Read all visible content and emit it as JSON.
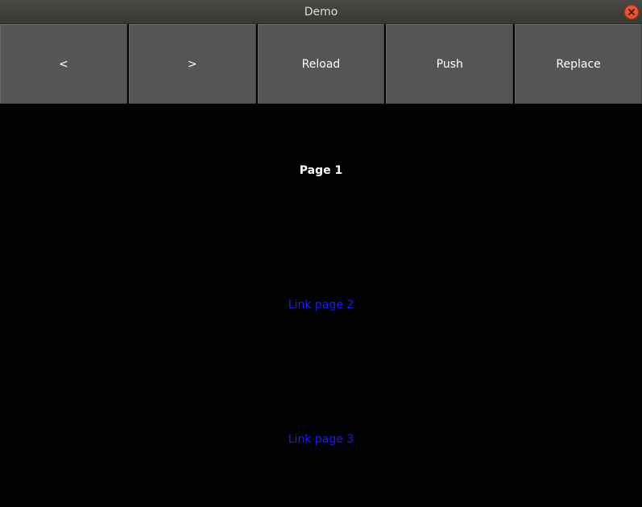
{
  "window": {
    "title": "Demo",
    "close_icon": "close-icon"
  },
  "toolbar": {
    "back_label": "<",
    "forward_label": ">",
    "reload_label": "Reload",
    "push_label": "Push",
    "replace_label": "Replace"
  },
  "page": {
    "title": "Page 1",
    "links": [
      {
        "label": "Link page 2"
      },
      {
        "label": "Link page 3"
      }
    ]
  },
  "colors": {
    "background": "#000000",
    "button": "#555555",
    "link": "#1a1aff",
    "close": "#e9552c"
  }
}
